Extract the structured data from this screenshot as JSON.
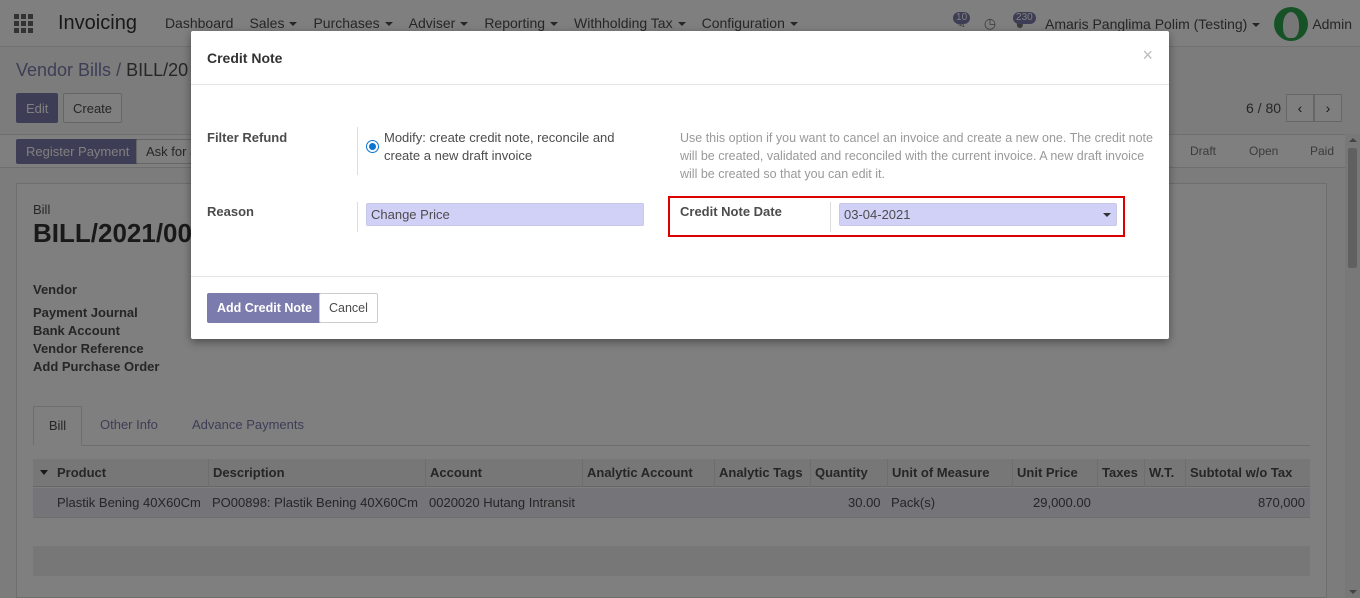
{
  "topnav": {
    "app_name": "Invoicing",
    "menu": [
      "Dashboard",
      "Sales",
      "Purchases",
      "Adviser",
      "Reporting",
      "Withholding Tax",
      "Configuration"
    ],
    "activity_badge": "10",
    "messages_badge": "230",
    "company": "Amaris Panglima Polim (Testing)",
    "user": "Admin"
  },
  "control_panel": {
    "breadcrumb_parent": "Vendor Bills",
    "breadcrumb_current": "BILL/20",
    "edit_label": "Edit",
    "create_label": "Create",
    "pager": "6 / 80"
  },
  "statusbar": {
    "register_payment": "Register Payment",
    "ask_for": "Ask for a",
    "stages": [
      "Draft",
      "Open",
      "Paid"
    ]
  },
  "sheet": {
    "bill_label": "Bill",
    "bill_name": "BILL/2021/00",
    "fields": [
      "Vendor",
      "Payment Journal",
      "Bank Account",
      "Vendor Reference",
      "Add Purchase Order"
    ],
    "tabs": [
      "Bill",
      "Other Info",
      "Advance Payments"
    ],
    "columns": [
      "Product",
      "Description",
      "Account",
      "Analytic Account",
      "Analytic Tags",
      "Quantity",
      "Unit of Measure",
      "Unit Price",
      "Taxes",
      "W.T.",
      "Subtotal w/o Tax"
    ],
    "row": {
      "product": "Plastik Bening 40X60Cm",
      "description": "PO00898: Plastik Bening 40X60Cm",
      "account": "0020020 Hutang Intransit",
      "quantity": "30.00",
      "uom": "Pack(s)",
      "unit_price": "29,000.00",
      "subtotal": "870,000"
    }
  },
  "modal": {
    "title": "Credit Note",
    "close": "×",
    "filter_refund_label": "Filter Refund",
    "filter_option": "Modify: create credit note, reconcile and create a new draft invoice",
    "help_text": "Use this option if you want to cancel an invoice and create a new one. The credit note will be created, validated and reconciled with the current invoice. A new draft invoice will be created so that you can edit it.",
    "reason_label": "Reason",
    "reason_value": "Change Price",
    "date_label": "Credit Note Date",
    "date_value": "03-04-2021",
    "add_button": "Add Credit Note",
    "cancel_button": "Cancel"
  }
}
